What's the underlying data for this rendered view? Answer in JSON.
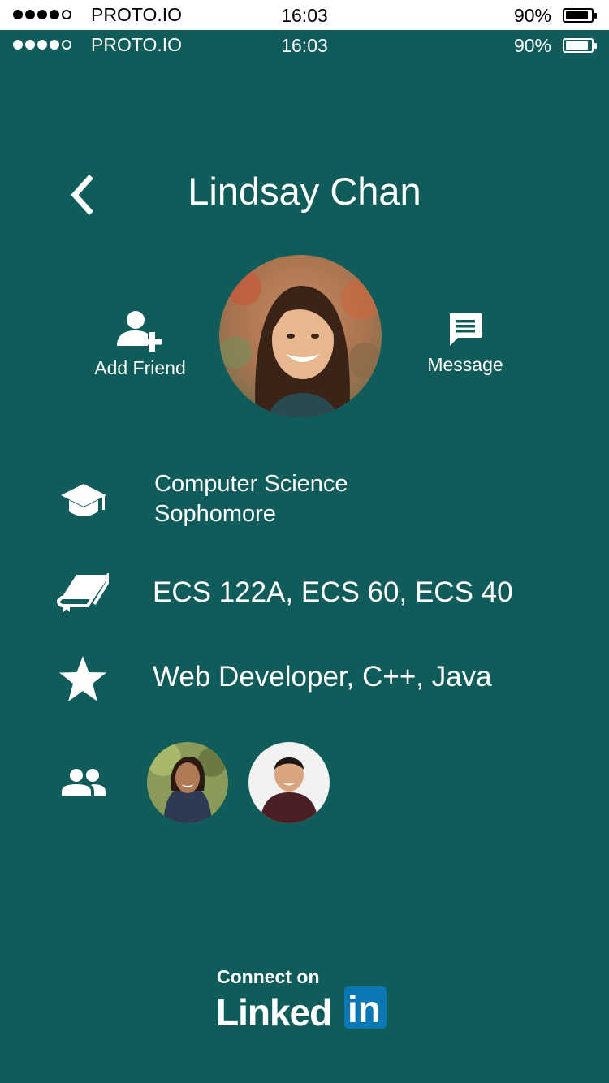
{
  "status_bar": {
    "carrier": "PROTO.IO",
    "time": "16:03",
    "battery": "90%",
    "battery_level": 0.9,
    "signal_bars": 4
  },
  "header": {
    "title": "Lindsay Chan",
    "back_icon": "chevron-left-icon"
  },
  "actions": {
    "add_friend": {
      "label": "Add Friend",
      "icon": "add-person-icon"
    },
    "message": {
      "label": "Message",
      "icon": "message-icon"
    }
  },
  "profile": {
    "major": "Computer Science",
    "year": "Sophomore",
    "courses": "ECS 122A, ECS 60, ECS 40",
    "skills": "Web Developer, C++, Java"
  },
  "linkedin": {
    "connect": "Connect on",
    "brand": "Linked",
    "brand_box": "in"
  },
  "colors": {
    "background": "#0f5c5a",
    "linkedin_blue": "#0a78b5"
  }
}
